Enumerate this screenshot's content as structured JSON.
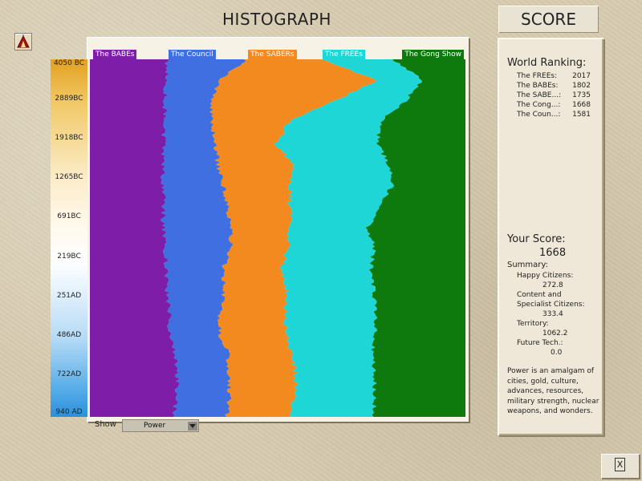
{
  "header": {
    "title": "HISTOGRAPH",
    "score_title": "SCORE"
  },
  "advisor_icon": "advisor-tent-icon",
  "scale": {
    "ticks": [
      "4050 BC",
      "2889BC",
      "1918BC",
      "1265BC",
      "691BC",
      "219BC",
      "251AD",
      "486AD",
      "722AD",
      "940 AD"
    ]
  },
  "chart_data": {
    "type": "area",
    "stacked": true,
    "percent_stacked": true,
    "orientation": "vertical-time",
    "y_axis_ticks": [
      "4050 BC",
      "2889BC",
      "1918BC",
      "1265BC",
      "691BC",
      "219BC",
      "251AD",
      "486AD",
      "722AD",
      "940 AD"
    ],
    "legend": "top",
    "legend_entries": [
      "The BABEs",
      "The Council",
      "The SABERs",
      "The FREEs",
      "The Gong Show"
    ],
    "series": [
      {
        "name": "The BABEs",
        "color": "#7e1ea8",
        "shares": [
          20.5,
          20.3,
          20.1,
          19.8,
          19.6,
          19.5,
          19.5,
          19.6,
          19.6,
          20.1,
          20.3,
          20.6,
          21.0,
          21.4,
          22.6,
          23.3,
          23.3,
          22.2
        ]
      },
      {
        "name": "The Council",
        "color": "#3f6fe0",
        "shares": [
          21.2,
          13.9,
          12.7,
          12.6,
          13.8,
          14.6,
          16.0,
          17.0,
          18.1,
          17.4,
          14.9,
          15.2,
          13.7,
          13.1,
          14.2,
          13.8,
          14.0,
          14.3
        ]
      },
      {
        "name": "The SABERs",
        "color": "#f28a1f",
        "shares": [
          19.8,
          42.1,
          32.0,
          20.5,
          16.3,
          19.9,
          18.0,
          16.7,
          15.6,
          15.2,
          15.7,
          16.8,
          17.3,
          17.8,
          17.0,
          17.7,
          17.4,
          16.6
        ]
      },
      {
        "name": "The FREEs",
        "color": "#1fd6d6",
        "shares": [
          19.3,
          12.4,
          18.9,
          24.3,
          27.1,
          25.5,
          27.0,
          23.3,
          20.8,
          23.0,
          23.8,
          23.0,
          24.0,
          23.6,
          21.4,
          20.9,
          21.1,
          22.4
        ]
      },
      {
        "name": "The Gong Show",
        "color": "#0e7a0e",
        "shares": [
          19.2,
          11.3,
          16.3,
          22.8,
          23.2,
          20.5,
          19.5,
          23.4,
          25.9,
          24.3,
          25.3,
          24.4,
          24.0,
          24.1,
          24.8,
          24.3,
          24.2,
          24.5
        ]
      }
    ]
  },
  "show": {
    "label": "Show",
    "value": "Power"
  },
  "score": {
    "world_ranking_title": "World Ranking:",
    "rankings": [
      {
        "name": "The FREEs:",
        "score": "2017"
      },
      {
        "name": "The BABEs:",
        "score": "1802"
      },
      {
        "name": "The SABE...:",
        "score": "1735"
      },
      {
        "name": "The Cong...:",
        "score": "1668"
      },
      {
        "name": "The Coun...:",
        "score": "1581"
      }
    ],
    "your_score_label": "Your Score:",
    "your_score": "1668",
    "summary_label": "Summary:",
    "happy_label": "Happy Citizens:",
    "happy_value": "272.8",
    "content_label_1": "Content and",
    "content_label_2": "Specialist Citizens:",
    "content_value": "333.4",
    "territory_label": "Territory:",
    "territory_value": "1062.2",
    "future_label": "Future Tech.:",
    "future_value": "0.0",
    "power_description": "Power is an amalgam of cities, gold, culture, advances, resources, military strength, nuclear weapons, and wonders."
  },
  "close_button": {
    "label": "X"
  }
}
